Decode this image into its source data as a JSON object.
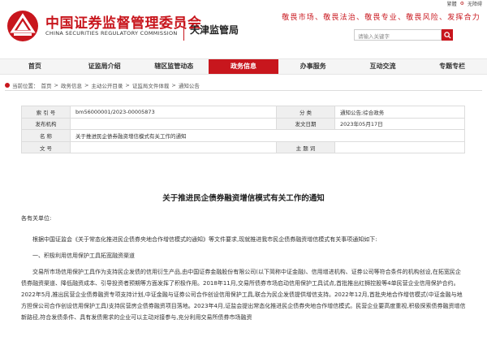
{
  "util": {
    "traditional": "繁體",
    "accessible": "无障碍"
  },
  "header": {
    "org_cn": "中国证券监督管理委员会",
    "org_en": "CHINA SECURITIES REGULATORY COMMISSION",
    "bureau": "天津监管局",
    "slogan": "敬畏市场、敬畏法治、敬畏专业、敬畏风险、发挥合力",
    "search_placeholder": "请输入关键字",
    "brand_color": "#c8161d"
  },
  "nav": {
    "items": [
      "首页",
      "证监局介绍",
      "辖区监管动态",
      "政务信息",
      "办事服务",
      "互动交流",
      "专题专栏"
    ],
    "active_index": 3
  },
  "breadcrumb": {
    "prefix": "当前位置：",
    "items": [
      "首页",
      "政务信息",
      "主动公开目录",
      "证监局文件体裁",
      "通知公告"
    ],
    "separator": ">"
  },
  "meta": {
    "index_label": "索 引 号",
    "index_value": "bm56000001/2023-00005873",
    "category_label": "分 类",
    "category_value": "通知公告;综合政务",
    "issuer_label": "发布机构",
    "issuer_value": "",
    "date_label": "发文日期",
    "date_value": "2023年05月17日",
    "name_label": "名 称",
    "name_value": "关于推进民企债券融资增信模式有关工作的通知",
    "docno_label": "文 号",
    "docno_value": "",
    "topic_label": "主 题 词",
    "topic_value": ""
  },
  "article": {
    "title": "关于推进民企债券融资增信模式有关工作的通知",
    "addressee": "各有关单位:",
    "para1": "根据中国证监会《关于常态化推进民企债券央地合作增信模式的通知》等文件要求,现就推进我市民企债券融资增信模式有关事项通知如下:",
    "section1": "一、积极利用信用保护工具拓宽融资渠道",
    "para2": "交易所市场信用保护工具作为支持民企发债的信用衍生产品,由中国证券金融股份有限公司(以下简称中证金融)、信用增进机构、证券公司等符合条件的机构创设,在拓宽民企债券融资渠道、降低融资成本、引导投资者预期等方面发挥了积极作用。2018年11月,交易所债券市场启动信用保护工具试点,首批推出红狮控股等4单民营企业信用保护合约。2022年5月,推出民营企业债券融资专项支持计划,中证金融与证券公司合作创设信用保护工具,联合为民企发债提供增信支持。2022年12月,首批央地合作增信模式(中证金融与地方担保公司合作创设信用保护工具)支持民营房企债券融资项目落地。2023年4月,证监会提出常态化推进民企债券央地合作增信模式。民营企业要高度重视,积极探索债券融资增信新路径,符合发债条件、具有发债需求的企业可以主动对接参与,充分利用交易所债券市场融资"
  }
}
